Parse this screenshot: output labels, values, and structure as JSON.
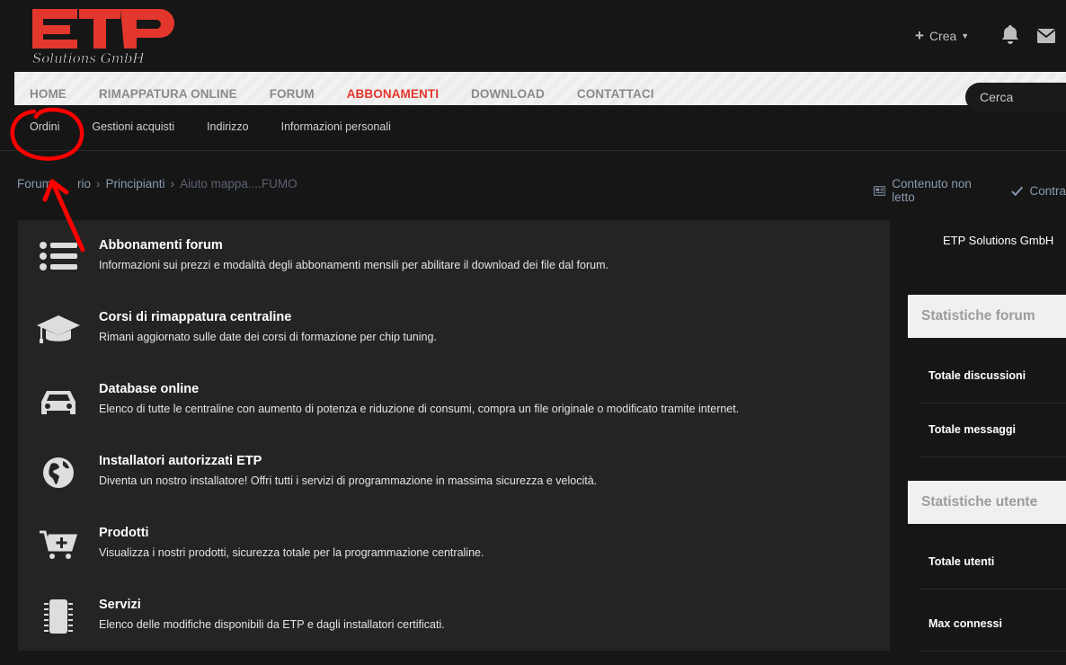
{
  "brand": {
    "logo_text": "ETP",
    "logo_script": "Solutions GmbH"
  },
  "header": {
    "create_label": "Crea"
  },
  "nav": {
    "items": [
      {
        "label": "HOME"
      },
      {
        "label": "RIMAPPATURA ONLINE"
      },
      {
        "label": "FORUM"
      },
      {
        "label": "ABBONAMENTI",
        "active": true
      },
      {
        "label": "DOWNLOAD"
      },
      {
        "label": "CONTATTACI"
      }
    ],
    "search_placeholder": "Cerca"
  },
  "subnav": {
    "items": [
      {
        "label": "Ordini"
      },
      {
        "label": "Gestioni acquisti"
      },
      {
        "label": "Indirizzo"
      },
      {
        "label": "Informazioni personali"
      }
    ]
  },
  "breadcrumb": {
    "items": [
      "Forum",
      "Principianti",
      "Aiuto mappa....FUMO"
    ],
    "hidden_fragment": "rio",
    "right": [
      "Contenuto non letto",
      "Contra"
    ]
  },
  "main": {
    "items": [
      {
        "icon": "list-icon",
        "title": "Abbonamenti forum",
        "desc": "Informazioni sui prezzi e modalità degli abbonamenti mensili per abilitare il download dei file dal forum."
      },
      {
        "icon": "graduation-cap-icon",
        "title": "Corsi di rimappatura centraline",
        "desc": "Rimani aggiornato sulle date dei corsi di formazione per chip tuning."
      },
      {
        "icon": "car-icon",
        "title": "Database online",
        "desc": "Elenco di tutte le centraline con aumento di potenza e riduzione di consumi, compra un file originale o modificato tramite internet."
      },
      {
        "icon": "globe-icon",
        "title": "Installatori autorizzati ETP",
        "desc": "Diventa un nostro installatore! Offri tutti i servizi di programmazione in massima sicurezza e velocità."
      },
      {
        "icon": "cart-add-icon",
        "title": "Prodotti",
        "desc": "Visualizza i nostri prodotti, sicurezza totale per la programmazione centraline."
      },
      {
        "icon": "chip-icon",
        "title": "Servizi",
        "desc": "Elenco delle modifiche disponibili da ETP e dagli installatori certificati."
      }
    ]
  },
  "sidebar": {
    "company": "ETP Solutions GmbH",
    "forum_stats": {
      "title": "Statistiche forum",
      "rows": [
        "Totale discussioni",
        "Totale messaggi"
      ]
    },
    "user_stats": {
      "title": "Statistiche utente",
      "rows": [
        "Totale utenti",
        "Max connessi"
      ]
    }
  },
  "colors": {
    "accent": "#e3372d",
    "background": "#161616",
    "panel": "#242424",
    "annotation": "#ff0000"
  }
}
